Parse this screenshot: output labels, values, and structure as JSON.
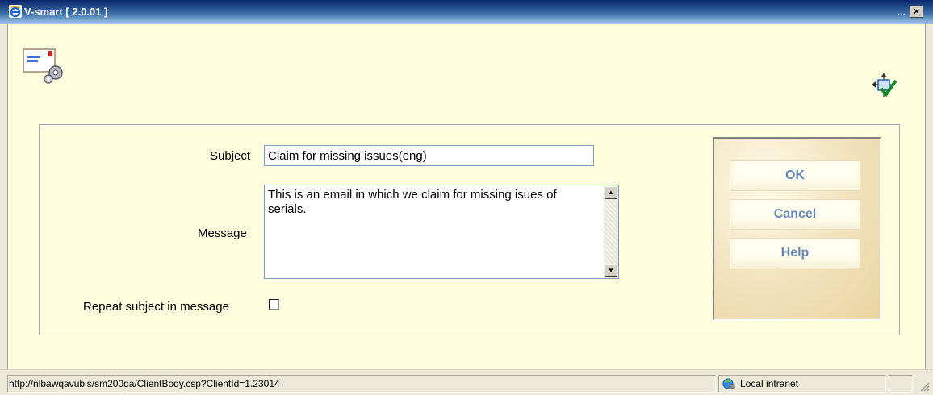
{
  "window": {
    "title": "V-smart [ 2.0.01 ]",
    "ellipsis": "...",
    "close_glyph": "×"
  },
  "form": {
    "subject_label": "Subject",
    "subject_value": "Claim for missing issues(eng)",
    "message_label": "Message",
    "message_value": "This is an email in which we claim for missing isues of serials.",
    "repeat_label": "Repeat subject in message",
    "repeat_checked": false
  },
  "buttons": {
    "ok": "OK",
    "cancel": "Cancel",
    "help": "Help"
  },
  "statusbar": {
    "url": "http://nlbawqavubis/sm200qa/ClientBody.csp?ClientId=1.23014",
    "zone": "Local intranet"
  },
  "icons": {
    "app": "ie-icon",
    "left_tool": "email-settings-icon",
    "right_tool": "confirm-layout-icon",
    "zone": "intranet-icon"
  },
  "colors": {
    "content_bg": "#ffffe0",
    "button_text": "#6a86b3",
    "titlebar": "#0a246a"
  }
}
